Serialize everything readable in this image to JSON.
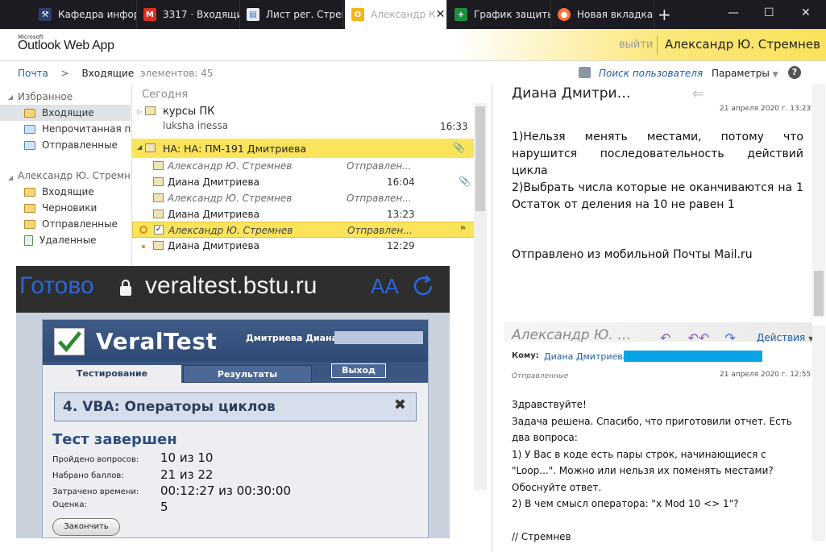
{
  "browser": {
    "tabs": [
      {
        "label": "Кафедра инфор",
        "icon": "school-icon"
      },
      {
        "label": "3317 · Входящие",
        "icon": "gmail-icon"
      },
      {
        "label": "Лист рег. Стремн",
        "icon": "document-icon"
      },
      {
        "label": "Александр К",
        "icon": "outlook-icon",
        "active": true
      },
      {
        "label": "График защиты",
        "icon": "sheets-icon"
      },
      {
        "label": "Новая вкладка",
        "icon": "firefox-icon"
      }
    ],
    "new_tab": "+",
    "close_glyph": "✕",
    "minimize_glyph": "—",
    "maximize_glyph": "☐"
  },
  "header": {
    "brand_small": "Microsoft",
    "brand": "Outlook Web App",
    "logout": "выйти",
    "user": "Александр Ю. Стремнев"
  },
  "nav": {
    "mail": "Почта",
    "arrow": ">",
    "folder": "Входящие",
    "count": "элементов: 45",
    "find_people": "Поиск пользователя",
    "params": "Параметры",
    "help": "?"
  },
  "folders": {
    "favorites": "Избранное",
    "fav_items": [
      "Входящие",
      "Непрочитанная почта",
      "Отправленные"
    ],
    "mailbox": "Александр Ю. Стремнев",
    "mailbox_items": [
      "Входящие",
      "Черновики",
      "Отправленные",
      "Удаленные"
    ]
  },
  "list": {
    "today": "Сегодня",
    "rows": [
      {
        "from": "курсы ПК",
        "sub": "luksha inessa",
        "time": "16:33"
      },
      {
        "conv": "НА: НА: ПМ-191 Дмитриева"
      },
      {
        "from": "Александр Ю. Стремнев",
        "status": "Отправлен..."
      },
      {
        "from": "Диана Дмитриева",
        "time": "16:04"
      },
      {
        "from": "Александр Ю. Стремнев",
        "status": "Отправлен..."
      },
      {
        "from": "Диана Дмитриева",
        "time": "13:23"
      },
      {
        "from": "Александр Ю. Стремнев",
        "status": "Отправлен..."
      },
      {
        "from": "Диана Дмитриева",
        "time": "12:29"
      }
    ]
  },
  "overlay": {
    "done": "Готово",
    "url": "veraltest.bstu.ru",
    "aa": "AA",
    "brand": "VeralTest",
    "user": "Дмитриева Диана",
    "tabs": [
      "Тестирование",
      "Результаты",
      "Выход"
    ],
    "test_title": "4. VBA: Операторы циклов",
    "close": "✖",
    "finished": "Тест завершен",
    "stats": [
      {
        "label": "Пройдено вопросов:",
        "value": "10 из 10"
      },
      {
        "label": "Набрано баллов:",
        "value": "21 из 22"
      },
      {
        "label": "Затрачено времени:",
        "value": "00:12:27 из 00:30:00"
      },
      {
        "label": "Оценка:",
        "value": "5"
      }
    ],
    "finish_button": "Закончить"
  },
  "reading": {
    "title": "Диана Дмитри…",
    "date": "21 апреля 2020 г. 13:23",
    "body1": [
      "1)Нельзя менять местами, потому что нарушится последовательность действий цикла",
      "2)Выбрать числа которые не оканчиваются на 1 Остаток от деления на 10 не равен 1"
    ],
    "mobile": "Отправлено из мобильной Почты Mail.ru",
    "from2": "Александр Ю. …",
    "actions": "Действия",
    "to_label": "Кому:",
    "to_value": "Диана Дмитриева",
    "sent": "Отправленные",
    "date2": "21 апреля 2020 г. 12:55",
    "body2": [
      "Здравствуйте!",
      "Задача решена. Спасибо, что приготовили отчет.  Есть два вопроса:",
      "1)  У Вас в коде есть пары строк, начинающиеся с \"Loop...\". Можно или нельзя их поменять местами? Обоснуйте ответ.",
      "2) В чем смысл оператора: \"x Mod 10 <> 1\"?",
      "",
      "// Стремнев"
    ]
  }
}
